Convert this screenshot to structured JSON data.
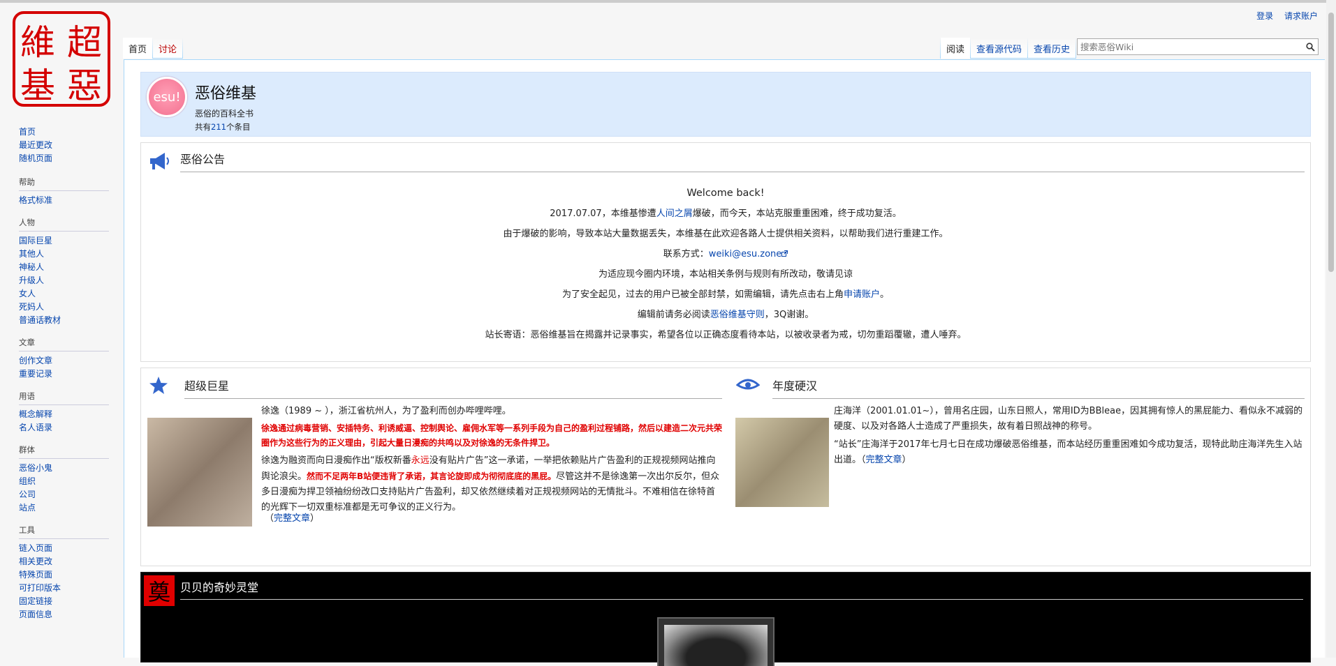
{
  "logo": {
    "chars": [
      "超",
      "惡",
      "維",
      "基"
    ]
  },
  "personal": {
    "login": "登录",
    "request_account": "请求账户"
  },
  "tabs": {
    "main": "首页",
    "discussion": "讨论",
    "read": "阅读",
    "view_source": "查看源代码",
    "view_history": "查看历史"
  },
  "search": {
    "placeholder": "搜索恶俗Wiki"
  },
  "sidebar": {
    "nav": [
      "首页",
      "最近更改",
      "随机页面"
    ],
    "sections": [
      {
        "title": "帮助",
        "items": [
          "格式标准"
        ]
      },
      {
        "title": "人物",
        "items": [
          "国际巨星",
          "其他人",
          "神秘人",
          "升级人",
          "女人",
          "死妈人",
          "普通话教材"
        ]
      },
      {
        "title": "文章",
        "items": [
          "创作文章",
          "重要记录"
        ]
      },
      {
        "title": "用语",
        "items": [
          "概念解释",
          "名人语录"
        ]
      },
      {
        "title": "群体",
        "items": [
          "恶俗小鬼",
          "组织",
          "公司",
          "站点"
        ]
      },
      {
        "title": "工具",
        "items": [
          "链入页面",
          "相关更改",
          "特殊页面",
          "可打印版本",
          "固定链接",
          "页面信息"
        ]
      }
    ]
  },
  "banner": {
    "badge": "esu!",
    "title": "恶俗维基",
    "subtitle": "恶俗的百科全书",
    "count_prefix": "共有",
    "count": "211",
    "count_suffix": "个条目"
  },
  "notice": {
    "title": "恶俗公告",
    "welcome": "Welcome back!",
    "l1a": "2017.07.07，本维基惨遭",
    "l1link": "人间之屑",
    "l1b": "爆破，而今天，本站克服重重困难，终于成功复活。",
    "l2": "由于爆破的影响，导致本站大量数据丢失，本维基在此欢迎各路人士提供相关资料，以帮助我们进行重建工作。",
    "l3a": "联系方式：",
    "l3link": "weiki@esu.zone",
    "l4": "为适应现今圈内环境，本站相关条例与规则有所改动，敬请见谅",
    "l5a": "为了安全起见，过去的用户已被全部封禁，如需编辑，请先点击右上角",
    "l5link": "申请账户",
    "l5b": "。",
    "l6a": "编辑前请务必阅读",
    "l6link": "恶俗维基守则",
    "l6b": "，3Q谢谢。",
    "l7": "站长寄语：恶俗维基旨在揭露并记录事实，希望各位以正确态度看待本站，以被收录者为戒，切勿重蹈覆辙，遭人唾弃。"
  },
  "superstar": {
    "title": "超级巨星",
    "p1": "徐逸（1989 ~ ），浙江省杭州人，为了盈利而创办哔哩哔哩。",
    "p2": "徐逸通过病毒营销、安插特务、利诱威逼、控制舆论、雇佣水军等一系列手段为自己的盈利过程铺路，然后以建造二次元共荣圈作为这些行为的正义理由，引起大量日漫痴的共鸣以及对徐逸的无条件捍卫。",
    "p3a": "徐逸为融资而向日漫痴作出“版权新番",
    "p3red": "永远",
    "p3b": "没有贴片广告”这一承诺，一举把依赖贴片广告盈利的正规视频网站推向舆论浪尖。",
    "p3bold": "然而不足两年B站便违背了承诺，其言论旋即成为彻彻底底的黑屁。",
    "p3c": "尽管这并不是徐逸第一次出尔反尔，但众多日漫痴为捍卫领袖纷纷改口支持贴片广告盈利，却又依然继续着对正规视频网站的无情批斗。不难相信在徐特首的光辉下一切双重标准都是无可争议的正义行为。",
    "more_open": "（",
    "more": "完整文章",
    "more_close": "）"
  },
  "yearly": {
    "title": "年度硬汉",
    "p1": "庄海洋（2001.01.01~），曾用名庄园，山东日照人，常用ID为BBleae，因其拥有惊人的黑屁能力、看似永不减弱的硬度、以及对各路人士造成了严重损失，故有着日照战神的称号。",
    "p2": "“站长”庄海洋于2017年七月七日在成功爆破恶俗维基，而本站经历重重困难如今成功复活，现特此助庄海洋先生入站出道。",
    "more_open": "（",
    "more": "完整文章",
    "more_close": "）"
  },
  "bebe": {
    "badge": "奠",
    "title": "贝贝的奇妙灵堂"
  },
  "colors": {
    "link": "#0645ad",
    "red": "#e00000",
    "banner_bg": "#dcebfd",
    "icon_blue": "#3366cc"
  }
}
